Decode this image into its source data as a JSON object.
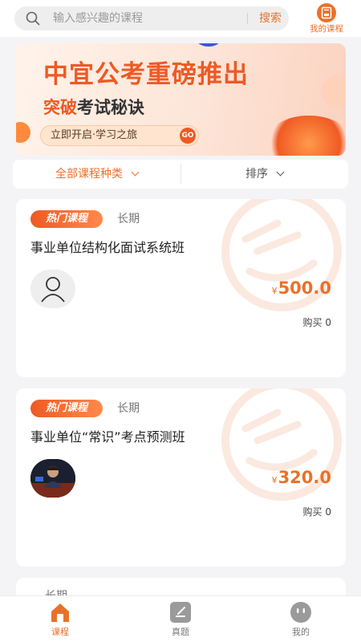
{
  "search": {
    "placeholder": "输入感兴趣的课程",
    "button_label": "搜索"
  },
  "header": {
    "my_courses_label": "我的课程"
  },
  "banner": {
    "title": "中宜公考重磅推出",
    "subtitle_highlight": "突破",
    "subtitle_rest": "考试秘诀",
    "cta": "立即开启·学习之旅",
    "go": "GO"
  },
  "filter": {
    "category_label": "全部课程种类",
    "sort_label": "排序"
  },
  "courses": [
    {
      "tag": "热门课程",
      "period": "长期",
      "title": "事业单位结构化面试系统班",
      "currency": "¥",
      "price": "500.0",
      "buy_count": "购买 0"
    },
    {
      "tag": "热门课程",
      "period": "长期",
      "title": "事业单位“常识”考点预测班",
      "currency": "¥",
      "price": "320.0",
      "buy_count": "购买 0"
    },
    {
      "period": "长期"
    }
  ],
  "nav": {
    "items": [
      "课程",
      "真题",
      "我的"
    ]
  },
  "colors": {
    "accent": "#e8722b",
    "banner_red": "#ee5a24",
    "background": "#f4f4f6"
  }
}
